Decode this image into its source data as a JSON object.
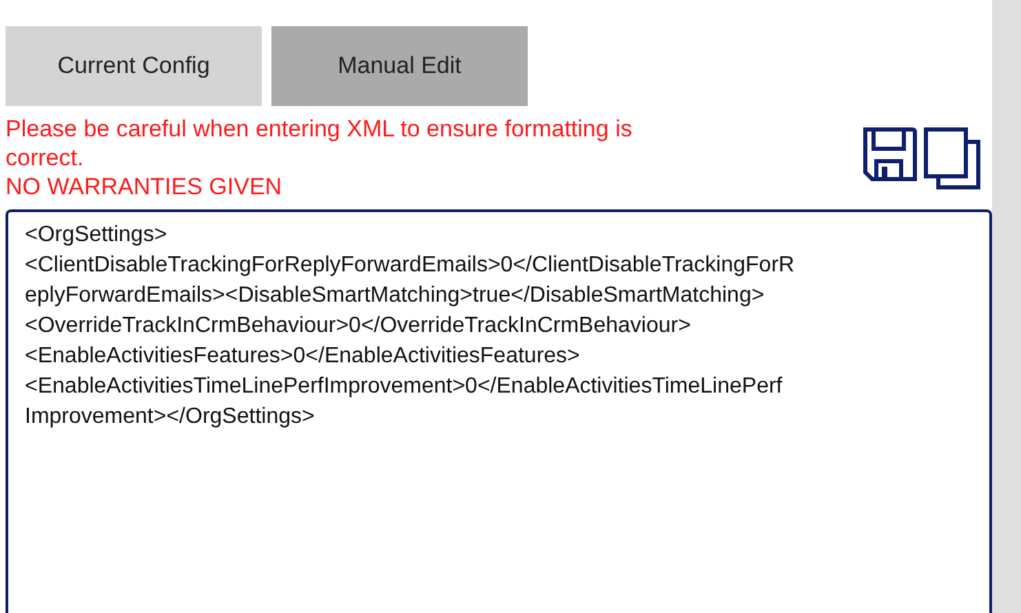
{
  "tabs": [
    {
      "label": "Current Config",
      "selected": false
    },
    {
      "label": "Manual Edit",
      "selected": true
    }
  ],
  "warning": [
    "Please be careful when entering XML to ensure formatting is correct.",
    "NO WARRANTIES GIVEN"
  ],
  "editor": {
    "lines": [
      "<OrgSettings>",
      "<ClientDisableTrackingForReplyForwardEmails>0</ClientDisableTrackingForR",
      "eplyForwardEmails><DisableSmartMatching>true</DisableSmartMatching>",
      "<OverrideTrackInCrmBehaviour>0</OverrideTrackInCrmBehaviour>",
      "<EnableActivitiesFeatures>0</EnableActivitiesFeatures>",
      "<EnableActivitiesTimeLinePerfImprovement>0</EnableActivitiesTimeLinePerf",
      "Improvement></OrgSettings>"
    ]
  }
}
